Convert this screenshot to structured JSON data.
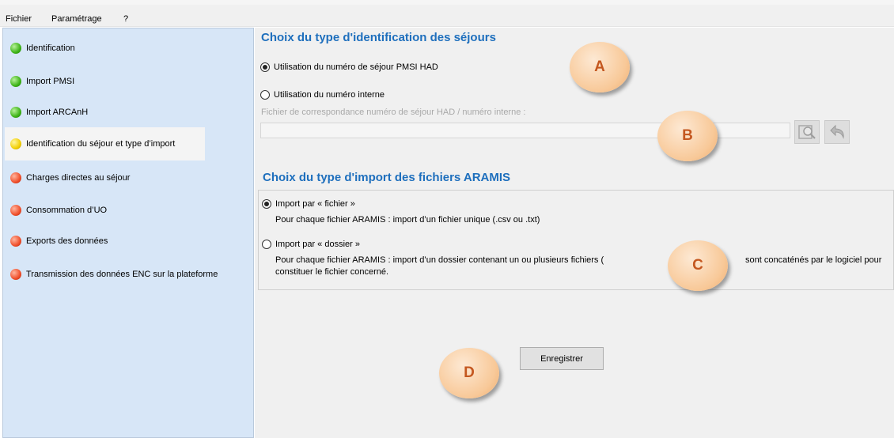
{
  "menu": [
    "Fichier",
    "Paramétrage",
    "?"
  ],
  "sidebar": {
    "items": [
      {
        "label": "Identification",
        "status": "green"
      },
      {
        "label": "Import PMSI",
        "status": "green"
      },
      {
        "label": "Import ARCAnH",
        "status": "green"
      },
      {
        "label": "Identification du séjour et type d’import",
        "status": "yellow"
      },
      {
        "label": "Charges directes au séjour",
        "status": "red"
      },
      {
        "label": "Consommation d’UO",
        "status": "red"
      },
      {
        "label": "Exports des données",
        "status": "red"
      },
      {
        "label": "Transmission des données ENC sur la plateforme",
        "status": "red"
      }
    ]
  },
  "identification": {
    "title": "Choix du type d'identification des séjours",
    "option_pmsi": "Utilisation du numéro de séjour PMSI HAD",
    "option_internal": "Utilisation du numéro interne",
    "selected": "pmsi",
    "file_label": "Fichier de correspondance numéro de séjour HAD / numéro interne :",
    "file_value": ""
  },
  "import": {
    "title": "Choix du type d'import des fichiers ARAMIS",
    "option_file": "Import par « fichier »",
    "option_file_desc": "Pour chaque fichier ARAMIS : import d’un fichier unique (.csv ou .txt)",
    "option_folder": "Import par « dossier »",
    "option_folder_desc_1a": "Pour chaque fichier ARAMIS : import d’un dossier contenant un ou plusieurs fichiers (",
    "option_folder_desc_1b": "sont concaténés par le logiciel pour",
    "option_folder_desc_2": "constituer le fichier concerné.",
    "selected": "file"
  },
  "save_label": "Enregistrer",
  "callouts": [
    "A",
    "B",
    "C",
    "D"
  ],
  "colors": {
    "title_blue": "#1e6fbd",
    "sidebar_bg": "#d7e6f7",
    "badge_text": "#c4571f"
  }
}
